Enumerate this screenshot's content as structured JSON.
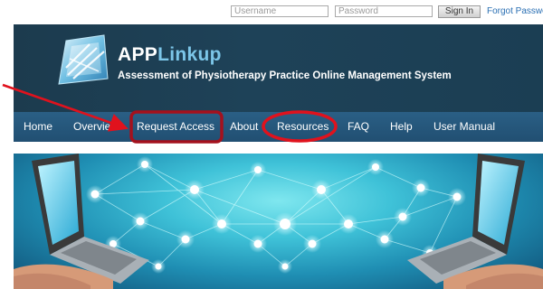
{
  "login": {
    "username_placeholder": "Username",
    "password_placeholder": "Password",
    "signin_label": "Sign In",
    "forgot_label": "Forgot Password"
  },
  "header": {
    "brand_app": "APP",
    "brand_linkup": "Linkup",
    "subtitle": "Assessment of Physiotherapy Practice Online Management System"
  },
  "nav": {
    "items": [
      "Home",
      "Overview",
      "Request Access",
      "About",
      "Resources",
      "FAQ",
      "Help",
      "User Manual"
    ]
  },
  "colors": {
    "header_bg": "#1e4258",
    "nav_bg": "#25577b",
    "brand_accent": "#7cc6e8",
    "highlight_box": "#a4111d",
    "highlight_oval": "#e0121d",
    "arrow": "#e0121d"
  },
  "icons": [
    "appl-logo-icon",
    "laptop-icon",
    "hand-icon",
    "network-node-icon",
    "arrow-annotation"
  ]
}
